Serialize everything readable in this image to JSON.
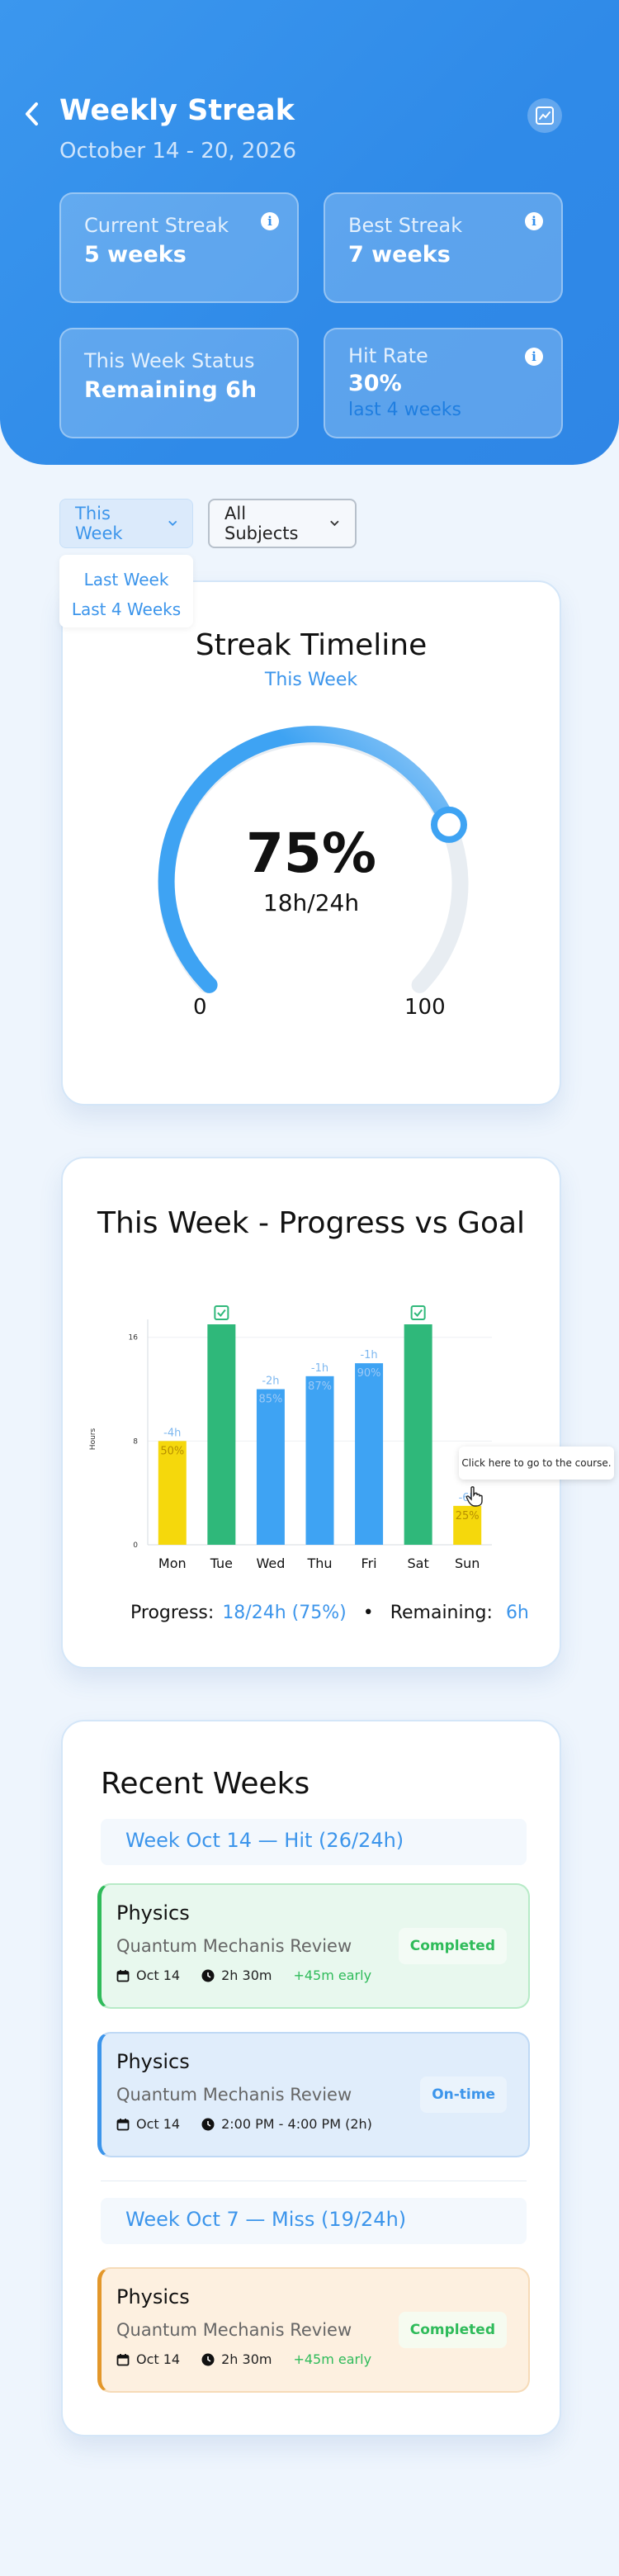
{
  "header": {
    "title": "Weekly Streak",
    "date_range": "October 14 - 20, 2026",
    "stats": [
      {
        "label": "Current Streak",
        "value": "5 weeks",
        "info": "i"
      },
      {
        "label": "Best Streak",
        "value": "7 weeks",
        "info": "i"
      },
      {
        "label": "This Week Status",
        "value": "Remaining 6h"
      },
      {
        "label": "Hit Rate",
        "value": "30%",
        "sub": "last 4 weeks",
        "info": "i"
      }
    ]
  },
  "filters": {
    "period": {
      "selected": "This Week",
      "options": [
        "Last Week",
        "Last 4 Weeks"
      ]
    },
    "subject": {
      "selected": "All Subjects"
    }
  },
  "streak": {
    "title": "Streak Timeline",
    "subtitle": "This Week",
    "percent": "75%",
    "percent_value": 75,
    "hours": "18h/24h",
    "min": "0",
    "max": "100"
  },
  "progress": {
    "title": "This Week - Progress vs Goal",
    "progress_label": "Progress:",
    "progress_value": "18/24h (75%)",
    "separator": "•",
    "remaining_label": "Remaining:",
    "remaining_value": "6h",
    "tooltip": "Click here to go to the course."
  },
  "chart_data": {
    "type": "bar",
    "ylabel": "Hours",
    "ylim": [
      0,
      17
    ],
    "yticks": [
      "0",
      "8",
      "16"
    ],
    "categories": [
      "Mon",
      "Tue",
      "Wed",
      "Thu",
      "Fri",
      "Sat",
      "Sun"
    ],
    "values": [
      8,
      17,
      12,
      13,
      14,
      17,
      3
    ],
    "above_labels": [
      "-4h",
      "",
      "-2h",
      "-1h",
      "-1h",
      "",
      "-6h"
    ],
    "inner_labels": [
      "50%",
      "",
      "85%",
      "87%",
      "90%",
      "",
      "25%"
    ],
    "goal_met": [
      false,
      true,
      false,
      false,
      false,
      true,
      false
    ],
    "colors": [
      "#f5d80c",
      "#2fb87a",
      "#3ea3f3",
      "#3ea3f3",
      "#3ea3f3",
      "#2fb87a",
      "#f5d80c"
    ]
  },
  "recent": {
    "title": "Recent Weeks",
    "weeks": [
      {
        "label": "Week Oct 14 — Hit (26/24h)"
      },
      {
        "label": "Week Oct 7 — Miss (19/24h)"
      }
    ],
    "sessions": [
      {
        "subject": "Physics",
        "topic": "Quantum Mechanis Review",
        "date": "Oct 14",
        "time": "2h 30m",
        "note": "+45m early",
        "status": "Completed"
      },
      {
        "subject": "Physics",
        "topic": "Quantum Mechanis Review",
        "date": "Oct 14",
        "time": "2:00 PM - 4:00 PM (2h)",
        "note": "",
        "status": "On-time"
      },
      {
        "subject": "Physics",
        "topic": "Quantum Mechanis Review",
        "date": "Oct 14",
        "time": "2h 30m",
        "note": "+45m early",
        "status": "Completed"
      }
    ]
  },
  "colors": {
    "primary": "#3c95eb",
    "success": "#2fbb5a",
    "warning": "#e3972a",
    "accent_yellow": "#f5d80c"
  }
}
